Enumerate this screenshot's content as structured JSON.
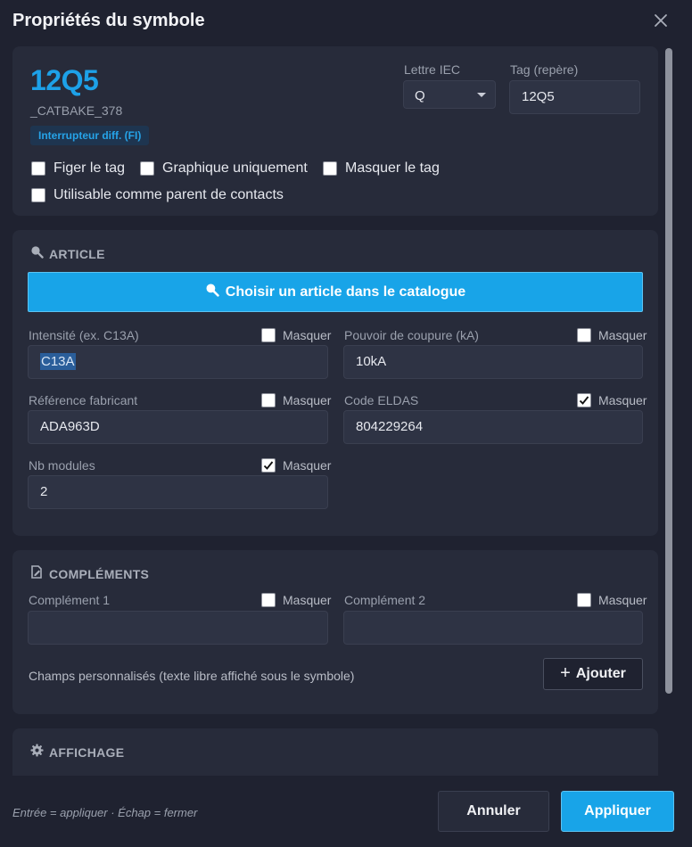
{
  "dialog": {
    "title": "Propriétés du symbole"
  },
  "identity": {
    "tag": "12Q5",
    "catalog_id": "_CATBAKE_378",
    "type_badge": "Interrupteur diff. (FI)",
    "iec_letter_label": "Lettre IEC",
    "iec_letter_value": "Q",
    "tag_label": "Tag (repère)",
    "tag_value": "12Q5",
    "options": [
      {
        "label": "Figer le tag",
        "checked": false
      },
      {
        "label": "Graphique uniquement",
        "checked": false
      },
      {
        "label": "Masquer le tag",
        "checked": false
      },
      {
        "label": "Utilisable comme parent de contacts",
        "checked": false
      }
    ]
  },
  "article": {
    "heading": "ARTICLE",
    "catalog_button": "Choisir un article dans le catalogue",
    "mask_label": "Masquer",
    "fields": [
      {
        "label": "Intensité (ex. C13A)",
        "value": "C13A",
        "masked": false
      },
      {
        "label": "Pouvoir de coupure (kA)",
        "value": "10kA",
        "masked": false
      },
      {
        "label": "Référence fabricant",
        "value": "ADA963D",
        "masked": false
      },
      {
        "label": "Code ELDAS",
        "value": "804229264",
        "masked": true
      },
      {
        "label": "Nb modules",
        "value": "2",
        "masked": true
      }
    ]
  },
  "complements": {
    "heading": "COMPLÉMENTS",
    "mask_label": "Masquer",
    "fields": [
      {
        "label": "Complément 1",
        "value": "",
        "masked": false
      },
      {
        "label": "Complément 2",
        "value": "",
        "masked": false
      }
    ],
    "custom_fields_text": "Champs personnalisés (texte libre affiché sous le symbole)",
    "add_button": "Ajouter"
  },
  "display": {
    "heading": "AFFICHAGE"
  },
  "footer": {
    "hint": "Entrée = appliquer  ·  Échap = fermer",
    "cancel": "Annuler",
    "apply": "Appliquer"
  },
  "colors": {
    "accent": "#18a4e8",
    "background": "#1f2230",
    "card": "#272b3a"
  },
  "icons": [
    "close-icon",
    "search-icon",
    "edit-document-icon",
    "gear-icon",
    "plus-icon",
    "check-icon",
    "chevron-down-icon"
  ]
}
